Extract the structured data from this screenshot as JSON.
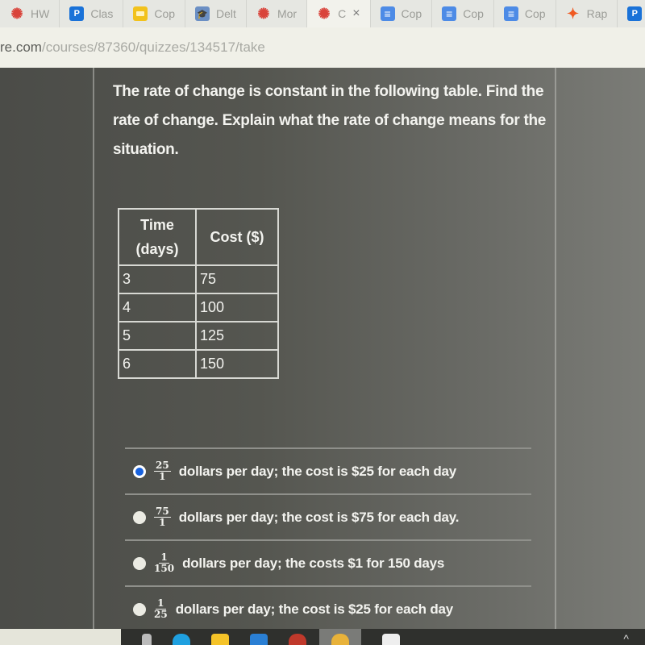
{
  "browser": {
    "tabs": [
      {
        "label": "HW",
        "icon": "canvas-icon"
      },
      {
        "label": "Clas",
        "icon": "pear-deck-icon"
      },
      {
        "label": "Cop",
        "icon": "google-slides-icon"
      },
      {
        "label": "Delt",
        "icon": "delta-math-icon"
      },
      {
        "label": "Mor",
        "icon": "canvas-icon"
      },
      {
        "label": "C",
        "icon": "canvas-icon",
        "active": true
      },
      {
        "label": "Cop",
        "icon": "google-docs-icon"
      },
      {
        "label": "Cop",
        "icon": "google-docs-icon"
      },
      {
        "label": "Cop",
        "icon": "google-docs-icon"
      },
      {
        "label": "Rap",
        "icon": "rap-icon"
      },
      {
        "label": "P",
        "icon": "pear-deck-icon"
      }
    ],
    "close_glyph": "×",
    "url_host": "re.com",
    "url_path": "/courses/87360/quizzes/134517/take"
  },
  "question": {
    "text": "The rate of change is constant in the following table. Find the rate of change. Explain what the rate of change means for the situation."
  },
  "table": {
    "headers": [
      "Time (days)",
      "Cost ($)"
    ],
    "header_time_line1": "Time",
    "header_time_line2": "(days)",
    "rows": [
      [
        "3",
        "75"
      ],
      [
        "4",
        "100"
      ],
      [
        "5",
        "125"
      ],
      [
        "6",
        "150"
      ]
    ]
  },
  "choices": [
    {
      "num": "25",
      "den": "1",
      "text": "dollars per day; the cost is $25 for each day",
      "selected": true
    },
    {
      "num": "75",
      "den": "1",
      "text": "dollars per day; the cost is $75 for each day.",
      "selected": false
    },
    {
      "num": "1",
      "den": "150",
      "text": "dollars per day; the costs $1 for 150 days",
      "selected": false
    },
    {
      "num": "1",
      "den": "25",
      "text": "dollars per day; the cost is $25 for each day",
      "selected": false
    }
  ],
  "taskbar": {
    "icons": [
      "task-view-icon",
      "edge-icon",
      "file-explorer-icon",
      "mail-icon",
      "app-icon",
      "chrome-icon",
      "store-icon"
    ],
    "tray_glyph": "^"
  },
  "colors": {
    "selected_radio": "#1862de",
    "page_bg": "#4a4b47"
  }
}
